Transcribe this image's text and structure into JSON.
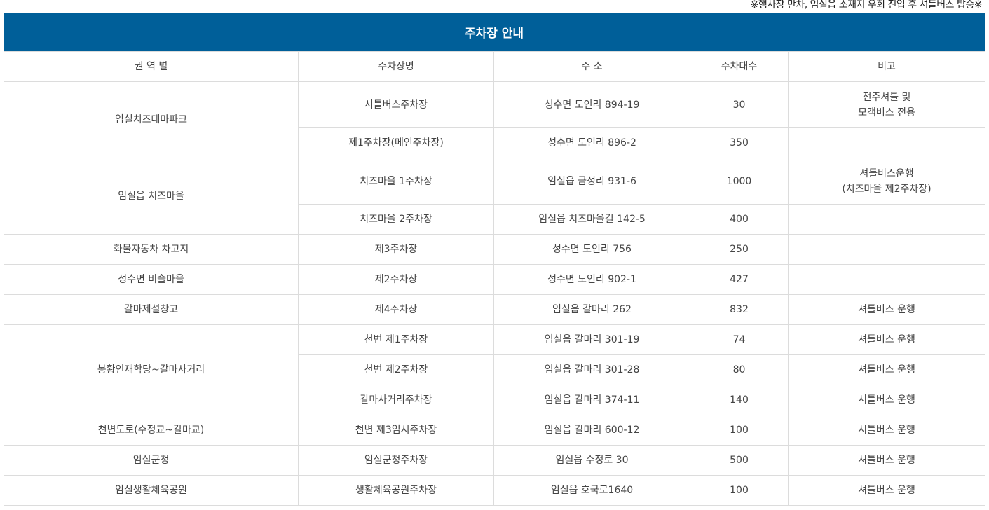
{
  "notice": "※행사장 만차, 임실읍 소재지 우회 진입 후 셔틀버스 탑승※",
  "title": "주차장 안내",
  "headers": [
    "권 역 별",
    "주차장명",
    "주 소",
    "주차대수",
    "비고"
  ],
  "rows": [
    {
      "region": "임실치즈테마파크",
      "name": "셔틀버스주차장",
      "address": "성수면 도인리 894-19",
      "capacity": "30",
      "note1": "전주셔틀 및",
      "note2": "모객버스 전용"
    },
    {
      "name": "제1주차장(메인주차장)",
      "address": "성수면 도인리 896-2",
      "capacity": "350",
      "note1": "",
      "note2": ""
    },
    {
      "region": "임실읍 치즈마을",
      "name": "치즈마을 1주차장",
      "address": "임실읍 금성리 931-6",
      "capacity": "1000",
      "note1": "셔틀버스운행",
      "note2": "(치즈마을 제2주차장)"
    },
    {
      "name": "치즈마을 2주차장",
      "address": "임실읍 치즈마을길 142-5",
      "capacity": "400",
      "note1": "",
      "note2": ""
    },
    {
      "region": "화물자동차 차고지",
      "name": "제3주차장",
      "address": "성수면 도인리 756",
      "capacity": "250",
      "note1": "",
      "note2": ""
    },
    {
      "region": "성수면 비슬마을",
      "name": "제2주차장",
      "address": "성수면 도인리 902-1",
      "capacity": "427",
      "note1": "",
      "note2": ""
    },
    {
      "region": "갈마제설창고",
      "name": "제4주차장",
      "address": "임실읍 갈마리 262",
      "capacity": "832",
      "note1": "셔틀버스 운행",
      "note2": ""
    },
    {
      "region": "봉황인재학당~갈마사거리",
      "name": "천변 제1주차장",
      "address": "임실읍 갈마리 301-19",
      "capacity": "74",
      "note1": "셔틀버스 운행",
      "note2": ""
    },
    {
      "name": "천변 제2주차장",
      "address": "임실읍 갈마리 301-28",
      "capacity": "80",
      "note1": "셔틀버스 운행",
      "note2": ""
    },
    {
      "name": "갈마사거리주차장",
      "address": "임실읍 갈마리 374-11",
      "capacity": "140",
      "note1": "셔틀버스 운행",
      "note2": ""
    },
    {
      "region": "천변도로(수정교~갈마교)",
      "name": "천변 제3임시주차장",
      "address": "임실읍 갈마리 600-12",
      "capacity": "100",
      "note1": "셔틀버스 운행",
      "note2": ""
    },
    {
      "region": "임실군청",
      "name": "임실군청주차장",
      "address": "임실읍 수정로 30",
      "capacity": "500",
      "note1": "셔틀버스 운행",
      "note2": ""
    },
    {
      "region": "임실생활체육공원",
      "name": "생활체육공원주차장",
      "address": "임실읍 호국로1640",
      "capacity": "100",
      "note1": "셔틀버스 운행",
      "note2": ""
    }
  ],
  "colors": {
    "header_bg": "#005f99",
    "header_text": "#ffffff",
    "border": "#dcdcdc",
    "text": "#444444"
  }
}
